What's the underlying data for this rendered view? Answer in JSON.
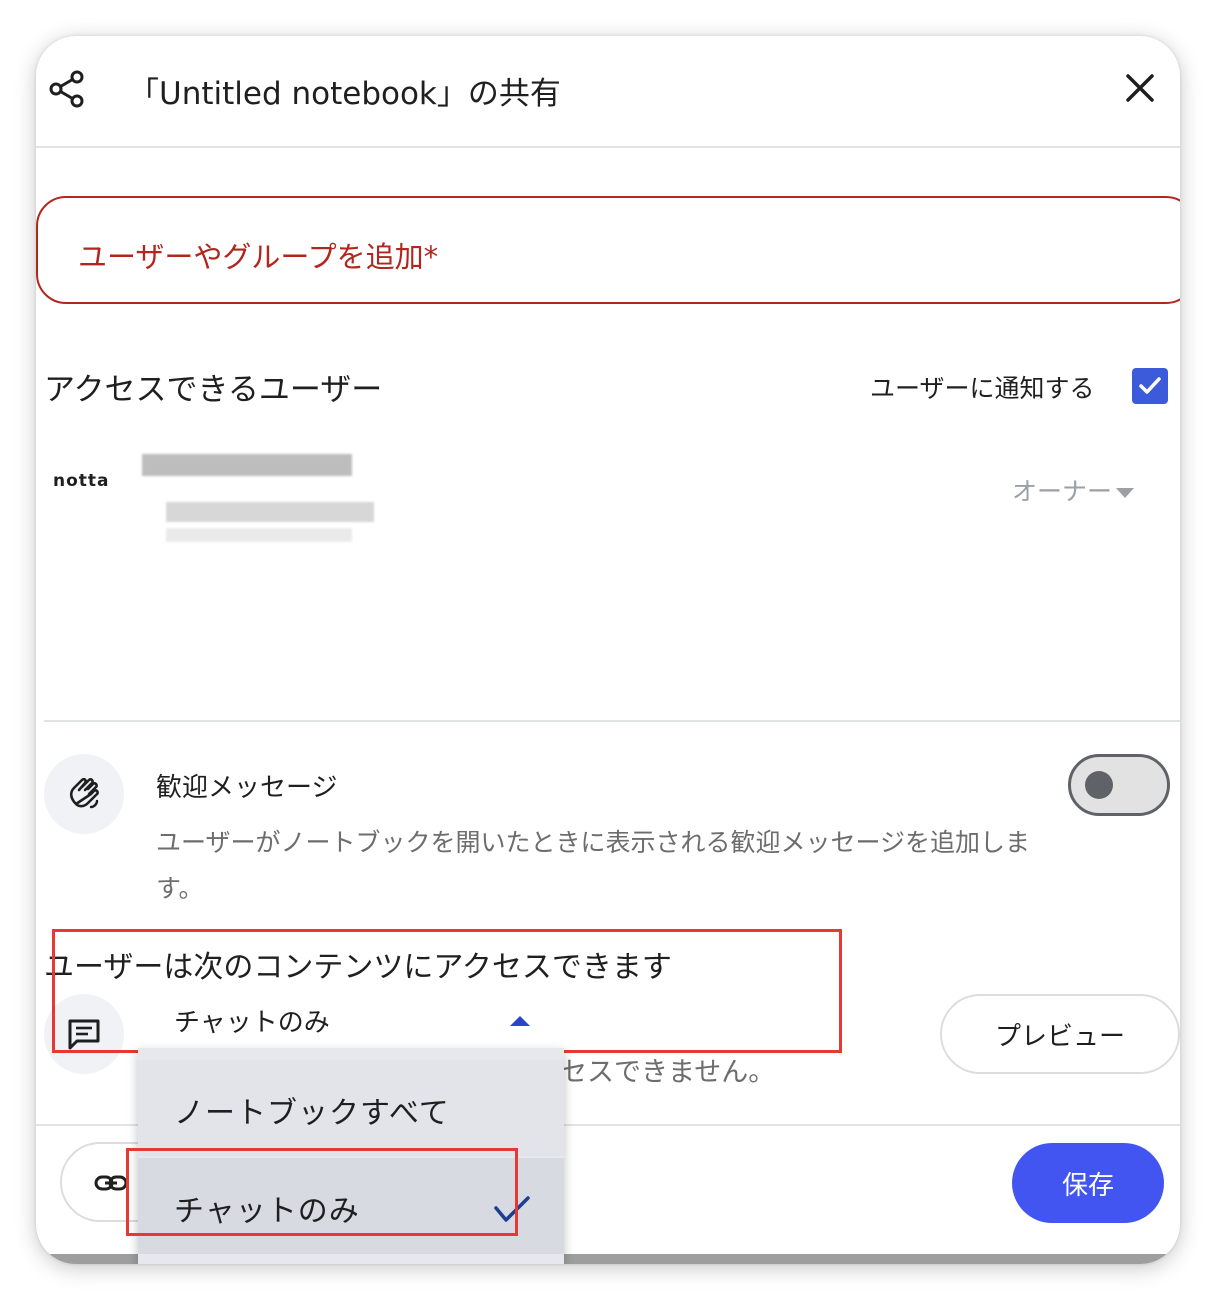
{
  "dialog": {
    "title": "「Untitled notebook」の共有",
    "share_icon": "share-icon",
    "close_icon": "close-icon"
  },
  "add_input": {
    "placeholder": "ユーザーやグループを追加*"
  },
  "access": {
    "title": "アクセスできるユーザー",
    "notify_label": "ユーザーに通知する",
    "notify_checked": true,
    "user": {
      "avatar_text": "notta",
      "role": "オーナー"
    }
  },
  "welcome": {
    "icon": "waving-hand-icon",
    "title": "歓迎メッセージ",
    "description": "ユーザーがノートブックを開いたときに表示される歓迎メッセージを追加します。",
    "enabled": false
  },
  "content_access": {
    "heading": "ユーザーは次のコンテンツにアクセスできます",
    "icon": "chat-icon",
    "selected": "チャットのみ",
    "hidden_text_fragment": "セスできません。",
    "options": [
      {
        "label": "ノートブックすべて",
        "selected": false
      },
      {
        "label": "チャットのみ",
        "selected": true
      }
    ]
  },
  "footer": {
    "preview_label": "プレビュー",
    "link_icon": "link-icon",
    "save_label": "保存"
  },
  "colors": {
    "accent": "#4355f0",
    "error": "#b3261e",
    "annotation": "#e53935"
  }
}
